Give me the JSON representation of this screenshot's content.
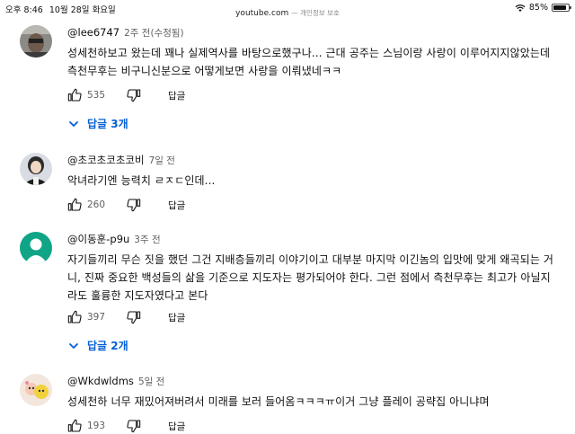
{
  "status_bar": {
    "time": "오후 8:46",
    "date": "10월 28일 화요일",
    "url": "youtube.com",
    "privacy": "— 개인정보 보호",
    "battery": "85%",
    "battery_level": 0.85
  },
  "comments": [
    {
      "author": "@lee6747",
      "time": "2주 전(수정됨)",
      "lines": [
        "성세천하보고 왔는데 꽤나 실제역사를 바탕으로했구나... 근대 공주는 스님이랑 사랑이 이루어지지않았는데",
        "측천무후는 비구니신분으로 어떻게보면 사랑을 이뤄냈네ㅋㅋ"
      ],
      "likes": "535",
      "reply_label": "답글",
      "replies_label": "답글 3개"
    },
    {
      "author": "@초코초코초코비",
      "time": "7일 전",
      "lines": [
        "악녀라기엔 능력치 ㄹㅈㄷ인데..."
      ],
      "likes": "260",
      "reply_label": "답글"
    },
    {
      "author": "@이동훈-p9u",
      "time": "3주 전",
      "lines": [
        "자기들끼리 무슨 짓을 했던 그건 지배층들끼리 이야기이고 대부분 마지막 이긴놈의 입맛에 맞게 왜곡되는 거",
        "니, 진짜 중요한 백성들의 삶을 기준으로 지도자는 평가되어야 한다. 그런 점에서 측천무후는 최고가 아닐지",
        "라도 훌륭한 지도자였다고 본다"
      ],
      "likes": "397",
      "reply_label": "답글",
      "replies_label": "답글 2개"
    },
    {
      "author": "@Wkdwldms",
      "time": "5일 전",
      "lines": [
        "성세천하 너무 재밌어져버려서 미래를 보러 들어옴ㅋㅋㅋㅠ이거 그냥 플레이 공략집 아니냐며"
      ],
      "likes": "193",
      "reply_label": "답글"
    }
  ],
  "colors": {
    "link_blue": "#065fd4",
    "secondary_text": "#606060",
    "default_avatar": "#0fa586"
  }
}
